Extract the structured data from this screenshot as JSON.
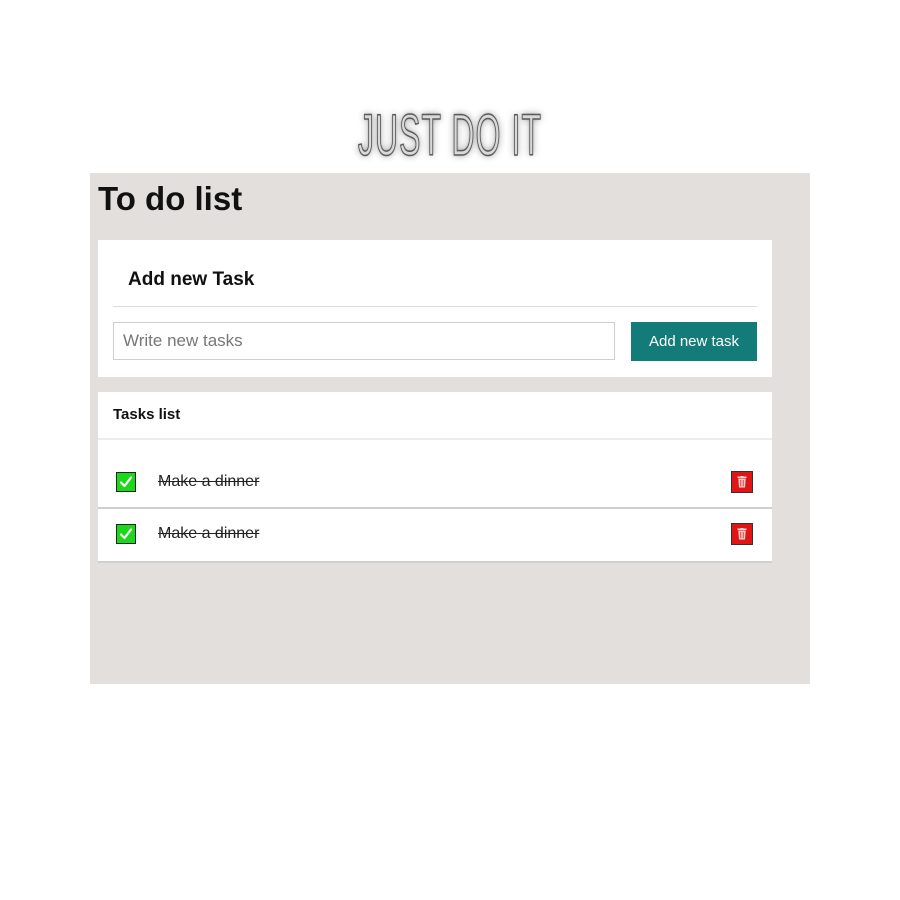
{
  "logo": {
    "text": "JUST DO IT"
  },
  "app": {
    "title": "To do list"
  },
  "add_task": {
    "heading": "Add new Task",
    "input_placeholder": "Write new tasks",
    "input_value": "",
    "button_label": "Add new task"
  },
  "tasks_list": {
    "heading": "Tasks list",
    "items": [
      {
        "text": "Make a dinner",
        "completed": true,
        "check_icon": "check-icon",
        "delete_icon": "trash-icon"
      },
      {
        "text": "Make a dinner",
        "completed": true,
        "check_icon": "check-icon",
        "delete_icon": "trash-icon"
      }
    ]
  },
  "colors": {
    "app_background": "#e2dfdd",
    "button": "#147c78",
    "check": "#1bd81b",
    "delete": "#e01616"
  }
}
